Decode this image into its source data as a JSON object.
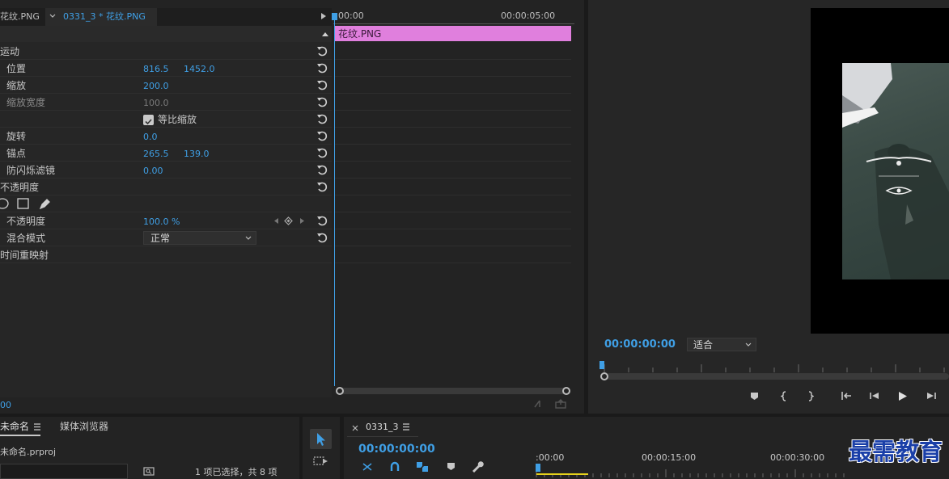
{
  "effect_controls": {
    "tab_source": "花纹.PNG",
    "tab_clip": "0331_3 * 花纹.PNG",
    "timecode_start": "00:00",
    "timecode_end": "00:00:05:00",
    "clip_label": "花纹.PNG",
    "bottom_timecode": "00",
    "rows": {
      "motion": "运动",
      "position_label": "位置",
      "position_x": "816.5",
      "position_y": "1452.0",
      "scale_label": "缩放",
      "scale_value": "200.0",
      "scale_width_label": "缩放宽度",
      "scale_width_value": "100.0",
      "uniform_scale_label": "等比缩放",
      "rotation_label": "旋转",
      "rotation_value": "0.0",
      "anchor_label": "锚点",
      "anchor_x": "265.5",
      "anchor_y": "139.0",
      "flicker_label": "防闪烁滤镜",
      "flicker_value": "0.00",
      "opacity_section": "不透明度",
      "opacity_label": "不透明度",
      "opacity_value": "100.0 %",
      "blend_label": "混合模式",
      "blend_value": "正常",
      "time_remap": "时间重映射"
    }
  },
  "program_monitor": {
    "timecode": "00:00:00:00",
    "fit_value": "适合"
  },
  "project_panel": {
    "tab_project": "未命名",
    "tab_media": "媒体浏览器",
    "project_file": "未命名.prproj",
    "status": "1 项已选择，共 8 项"
  },
  "timeline": {
    "tab": "0331_3",
    "timecode": "00:00:00:00",
    "ruler": [
      ":00:00",
      "00:00:15:00",
      "00:00:30:00"
    ]
  },
  "watermark": "最需教育",
  "colors": {
    "accent_blue": "#3f9fe5",
    "clip_pink": "#e07fdd",
    "panel_bg": "#232323"
  }
}
